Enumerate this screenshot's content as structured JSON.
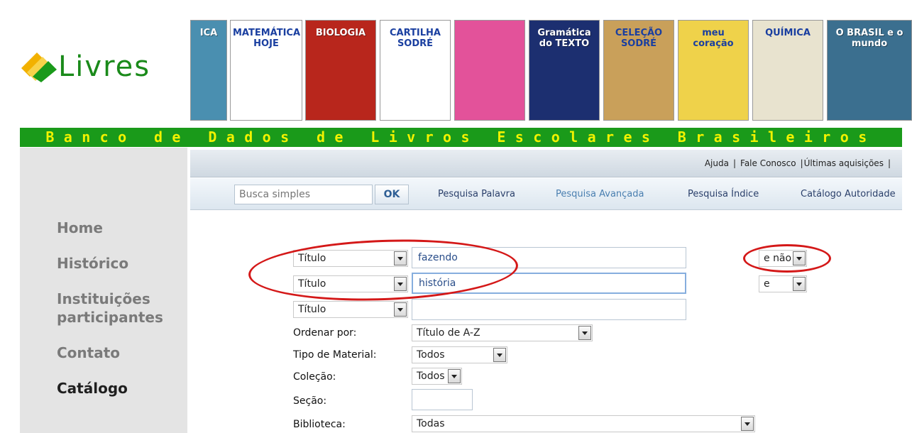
{
  "brand": {
    "name": "Livres",
    "tagline": "Banco de Dados de Livros Escolares Brasileiros"
  },
  "covers": [
    {
      "title": "ICA",
      "bg": "#4a8fb0"
    },
    {
      "title": "MATEMÁTICA HOJE",
      "bg": "#ffffff"
    },
    {
      "title": "BIOLOGIA",
      "bg": "#b8261c"
    },
    {
      "title": "CARTILHA SODRÉ",
      "bg": "#ffffff"
    },
    {
      "title": "",
      "bg": "#e3529a"
    },
    {
      "title": "Gramática do TEXTO",
      "bg": "#1c2f70"
    },
    {
      "title": "CELEÇÃO SODRÉ",
      "bg": "#c9a05a"
    },
    {
      "title": "meu coração",
      "bg": "#efd24a"
    },
    {
      "title": "QUÍMICA",
      "bg": "#e8e3cf"
    },
    {
      "title": "O BRASIL e o mundo",
      "bg": "#3b6f8f"
    }
  ],
  "colors": {
    "brand_green": "#1a9a1a",
    "tagline_yellow": "#f2f200",
    "annotation_red": "#d41818"
  },
  "nav": {
    "home": "Home",
    "historico": "Histórico",
    "instituicoes": "Instituições participantes",
    "contato": "Contato",
    "catalogo": "Catálogo"
  },
  "top_links": {
    "ajuda": "Ajuda",
    "fale_conosco": "Fale Conosco",
    "ultimas": "Últimas aquisições",
    "separator": "|"
  },
  "search": {
    "placeholder": "Busca simples",
    "ok": "OK",
    "palavra": "Pesquisa Palavra",
    "avancada": "Pesquisa Avançada",
    "indice": "Pesquisa Índice",
    "autoridade": "Catálogo Autoridade"
  },
  "form": {
    "rows": [
      {
        "field": "Título",
        "term": "fazendo",
        "operator": "e não"
      },
      {
        "field": "Título",
        "term": "história",
        "operator": "e"
      },
      {
        "field": "Título",
        "term": ""
      }
    ],
    "ordenar_label": "Ordenar por:",
    "ordenar_value": "Título de A-Z",
    "tipo_label": "Tipo de Material:",
    "tipo_value": "Todos",
    "colecao_label": "Coleção:",
    "colecao_value": "Todos",
    "secao_label": "Seção:",
    "secao_value": "",
    "biblioteca_label": "Biblioteca:",
    "biblioteca_value": "Todas"
  }
}
